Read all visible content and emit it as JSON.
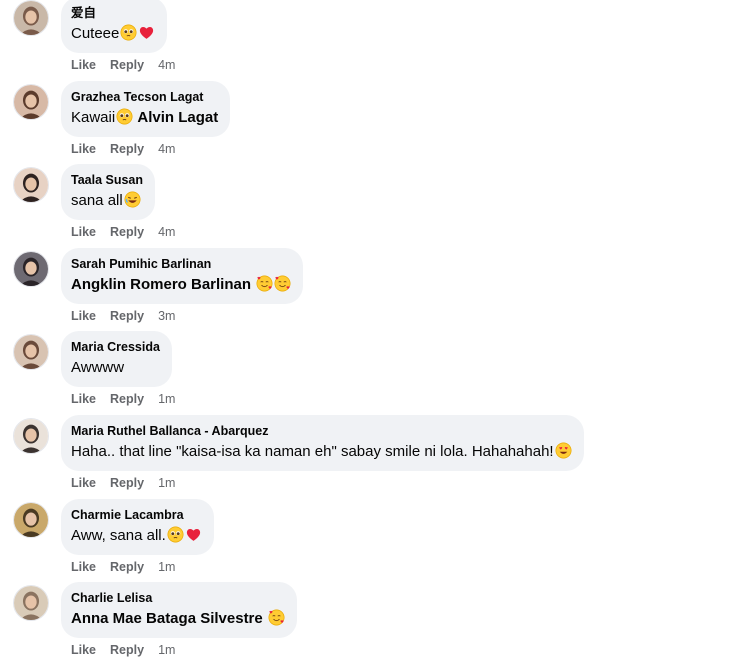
{
  "comments": [
    {
      "author": "爱自",
      "text_before": "Cuteee",
      "tag": "",
      "text_after": "",
      "emojis": [
        "pleading-face",
        "red-heart"
      ],
      "like_label": "Like",
      "reply_label": "Reply",
      "time": "4m",
      "avatar_colors": [
        "#c9b8a8",
        "#7a5b4a"
      ]
    },
    {
      "author": "Grazhea Tecson Lagat",
      "text_before": "Kawaii",
      "tag": "Alvin Lagat",
      "text_after": "",
      "emojis": [
        "pleading-face"
      ],
      "like_label": "Like",
      "reply_label": "Reply",
      "time": "4m",
      "avatar_colors": [
        "#d7b9a6",
        "#5b3b2c"
      ]
    },
    {
      "author": "Taala Susan",
      "text_before": "sana all",
      "tag": "",
      "text_after": "",
      "emojis": [
        "rolling-laughing-face"
      ],
      "like_label": "Like",
      "reply_label": "Reply",
      "time": "4m",
      "avatar_colors": [
        "#e7d2c4",
        "#2d2220"
      ]
    },
    {
      "author": "Sarah Pumihic Barlinan",
      "text_before": "",
      "tag": "Angklin Romero Barlinan",
      "text_after": "",
      "emojis": [
        "smiling-face-with-hearts",
        "smiling-face-with-hearts"
      ],
      "like_label": "Like",
      "reply_label": "Reply",
      "time": "3m",
      "avatar_colors": [
        "#6e6a72",
        "#2a2428"
      ]
    },
    {
      "author": "Maria Cressida",
      "text_before": "Awwww",
      "tag": "",
      "text_after": "",
      "emojis": [],
      "like_label": "Like",
      "reply_label": "Reply",
      "time": "1m",
      "avatar_colors": [
        "#d8c3b2",
        "#6a4a3a"
      ]
    },
    {
      "author": "Maria Ruthel Ballanca - Abarquez",
      "text_before": "Haha.. that line \"kaisa-isa ka naman eh\" sabay smile ni lola. Hahahahah!",
      "tag": "",
      "text_after": "",
      "emojis": [
        "heart-eyes-face"
      ],
      "like_label": "Like",
      "reply_label": "Reply",
      "time": "1m",
      "avatar_colors": [
        "#eae2da",
        "#3b3330"
      ]
    },
    {
      "author": "Charmie Lacambra",
      "text_before": "Aww, sana all.",
      "tag": "",
      "text_after": "",
      "emojis": [
        "pleading-face",
        "red-heart"
      ],
      "like_label": "Like",
      "reply_label": "Reply",
      "time": "1m",
      "avatar_colors": [
        "#c9a86a",
        "#4a3a22"
      ]
    },
    {
      "author": "Charlie Lelisa",
      "text_before": "",
      "tag": "Anna Mae Bataga Silvestre",
      "text_after": "",
      "emojis": [
        "smiling-face-with-hearts"
      ],
      "like_label": "Like",
      "reply_label": "Reply",
      "time": "1m",
      "avatar_colors": [
        "#d9cbb8",
        "#8a7360"
      ]
    }
  ]
}
